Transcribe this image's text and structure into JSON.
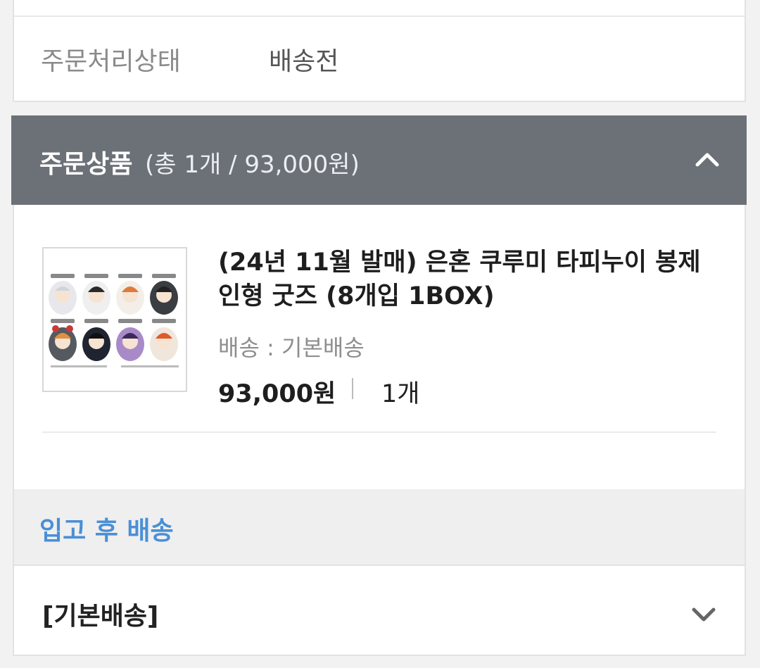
{
  "order_status": {
    "label": "주문처리상태",
    "value": "배송전"
  },
  "order_items": {
    "title": "주문상품",
    "summary": "(총 1개 / 93,000원)",
    "expanded": true
  },
  "product": {
    "name": "(24년 11월 발매) 은혼 쿠루미 타피누이 봉제 인형 굿즈 (8개입 1BOX)",
    "shipping": "배송 : 기본배송",
    "price": "93,000원",
    "quantity": "1개"
  },
  "restock_notice": "입고 후 배송",
  "shipping_section": {
    "label": "[기본배송]",
    "expanded": false
  },
  "colors": {
    "header_bg": "#6c7178",
    "accent_blue": "#4a8fd6"
  }
}
